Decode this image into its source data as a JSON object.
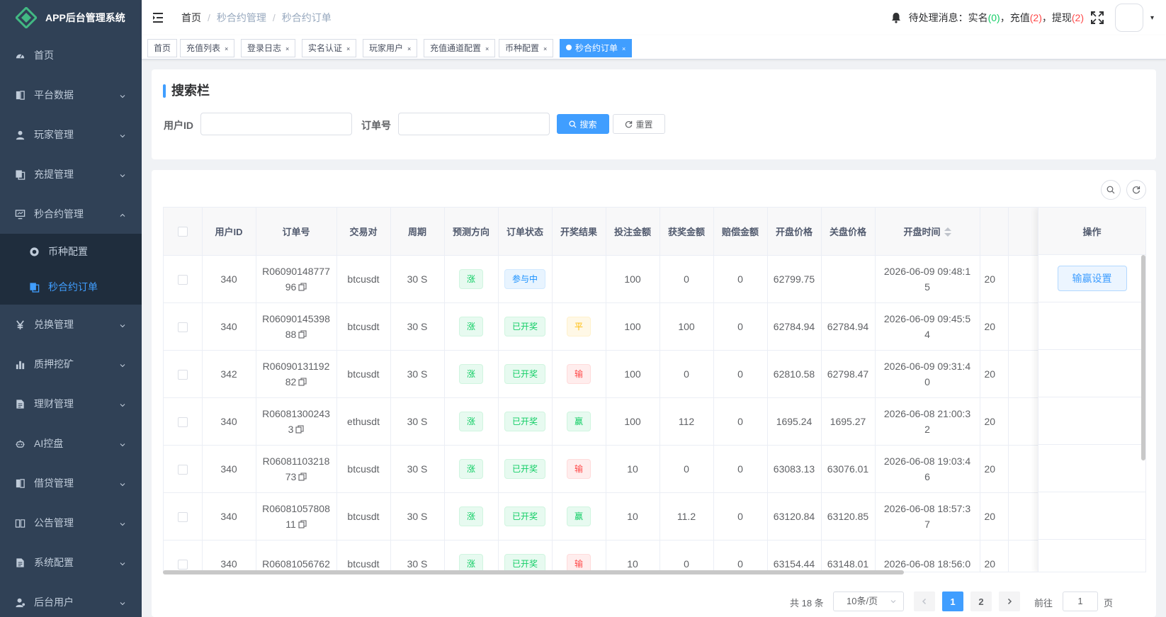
{
  "app": {
    "title": "APP后台管理系统"
  },
  "sidebar": {
    "items": [
      {
        "label": "首页",
        "icon": "dashboard-icon"
      },
      {
        "label": "平台数据",
        "icon": "book-icon"
      },
      {
        "label": "玩家管理",
        "icon": "user-icon"
      },
      {
        "label": "充提管理",
        "icon": "copy-icon"
      },
      {
        "label": "秒合约管理",
        "icon": "monitor-icon"
      },
      {
        "label": "兑换管理",
        "icon": "yen-icon"
      },
      {
        "label": "质押挖矿",
        "icon": "bar-chart-icon"
      },
      {
        "label": "理财管理",
        "icon": "document-icon"
      },
      {
        "label": "AI控盘",
        "icon": "robot-icon"
      },
      {
        "label": "借贷管理",
        "icon": "book-icon"
      },
      {
        "label": "公告管理",
        "icon": "open-book-icon"
      },
      {
        "label": "系统配置",
        "icon": "document-icon"
      },
      {
        "label": "后台用户",
        "icon": "user-admin-icon"
      }
    ],
    "submenu": [
      {
        "label": "币种配置",
        "icon": "coin-icon"
      },
      {
        "label": "秒合约订单",
        "icon": "copy-icon"
      }
    ]
  },
  "header": {
    "breadcrumb": [
      "首页",
      "秒合约管理",
      "秒合约订单"
    ],
    "sep": "/",
    "notice_prefix": "待处理消息：",
    "notice_realname": "实名",
    "notice_realname_count": "0",
    "notice_recharge": "充值",
    "notice_recharge_count": "2",
    "notice_withdraw": "提现",
    "notice_withdraw_count": "2",
    "caret": "▾"
  },
  "tags": [
    {
      "label": "首页",
      "closable": false
    },
    {
      "label": "充值列表",
      "closable": true
    },
    {
      "label": "登录日志",
      "closable": true
    },
    {
      "label": "实名认证",
      "closable": true
    },
    {
      "label": "玩家用户",
      "closable": true
    },
    {
      "label": "充值通道配置",
      "closable": true
    },
    {
      "label": "币种配置",
      "closable": true
    },
    {
      "label": "秒合约订单",
      "closable": true,
      "active": true
    }
  ],
  "search": {
    "title": "搜索栏",
    "user_id_label": "用户ID",
    "order_no_label": "订单号",
    "search_btn": "搜索",
    "reset_btn": "重置",
    "user_id_value": "",
    "order_no_value": ""
  },
  "table": {
    "columns": [
      "用户ID",
      "订单号",
      "交易对",
      "周期",
      "预测方向",
      "订单状态",
      "开奖结果",
      "投注金额",
      "获奖金额",
      "赔偿金额",
      "开盘价格",
      "关盘价格",
      "开盘时间"
    ],
    "action_column": "操作",
    "action_btn": "输赢设置",
    "rows": [
      {
        "user_id": "340",
        "order_a": "R06090148777",
        "order_b": "96",
        "pair": "btcusdt",
        "period": "30 S",
        "direction": "涨",
        "status": "参与中",
        "status_color": "blue",
        "result": "",
        "result_color": "",
        "bet": "100",
        "win": "0",
        "comp": "0",
        "open": "62799.75",
        "close": "",
        "time_a": "2026-06-09 09:48:1",
        "time_b": "5",
        "extra": "20"
      },
      {
        "user_id": "340",
        "order_a": "R06090145398",
        "order_b": "88",
        "pair": "btcusdt",
        "period": "30 S",
        "direction": "涨",
        "status": "已开奖",
        "status_color": "green",
        "result": "平",
        "result_color": "yellow",
        "bet": "100",
        "win": "100",
        "comp": "0",
        "open": "62784.94",
        "close": "62784.94",
        "time_a": "2026-06-09 09:45:5",
        "time_b": "4",
        "extra": "20"
      },
      {
        "user_id": "342",
        "order_a": "R06090131192",
        "order_b": "82",
        "pair": "btcusdt",
        "period": "30 S",
        "direction": "涨",
        "status": "已开奖",
        "status_color": "green",
        "result": "输",
        "result_color": "red",
        "bet": "100",
        "win": "0",
        "comp": "0",
        "open": "62810.58",
        "close": "62798.47",
        "time_a": "2026-06-09 09:31:4",
        "time_b": "0",
        "extra": "20"
      },
      {
        "user_id": "340",
        "order_a": "R06081300243",
        "order_b": "3",
        "pair": "ethusdt",
        "period": "30 S",
        "direction": "涨",
        "status": "已开奖",
        "status_color": "green",
        "result": "赢",
        "result_color": "green",
        "bet": "100",
        "win": "112",
        "comp": "0",
        "open": "1695.24",
        "close": "1695.27",
        "time_a": "2026-06-08 21:00:3",
        "time_b": "2",
        "extra": "20"
      },
      {
        "user_id": "340",
        "order_a": "R06081103218",
        "order_b": "73",
        "pair": "btcusdt",
        "period": "30 S",
        "direction": "涨",
        "status": "已开奖",
        "status_color": "green",
        "result": "输",
        "result_color": "red",
        "bet": "10",
        "win": "0",
        "comp": "0",
        "open": "63083.13",
        "close": "63076.01",
        "time_a": "2026-06-08 19:03:4",
        "time_b": "6",
        "extra": "20"
      },
      {
        "user_id": "340",
        "order_a": "R06081057808",
        "order_b": "11",
        "pair": "btcusdt",
        "period": "30 S",
        "direction": "涨",
        "status": "已开奖",
        "status_color": "green",
        "result": "赢",
        "result_color": "green",
        "bet": "10",
        "win": "11.2",
        "comp": "0",
        "open": "63120.84",
        "close": "63120.85",
        "time_a": "2026-06-08 18:57:3",
        "time_b": "7",
        "extra": "20"
      },
      {
        "user_id": "340",
        "order_a": "R06081056762",
        "order_b": "",
        "pair": "btcusdt",
        "period": "30 S",
        "direction": "涨",
        "status": "已开奖",
        "status_color": "green",
        "result": "输",
        "result_color": "red",
        "bet": "10",
        "win": "0",
        "comp": "0",
        "open": "63154.44",
        "close": "63148.01",
        "time_a": "2026-06-08 18:56:0",
        "time_b": "",
        "extra": "20"
      }
    ]
  },
  "pagination": {
    "total": "共 18 条",
    "page_size": "10条/页",
    "pages": [
      "1",
      "2"
    ],
    "current": "1",
    "goto_prefix": "前往",
    "goto_value": "1",
    "goto_suffix": "页"
  },
  "colors": {
    "sidebar_bg": "#304156",
    "submenu_bg": "#1f2d3d",
    "primary": "#409eff",
    "green": "#13ce66",
    "red": "#ff4949",
    "yellow": "#ffba00"
  }
}
